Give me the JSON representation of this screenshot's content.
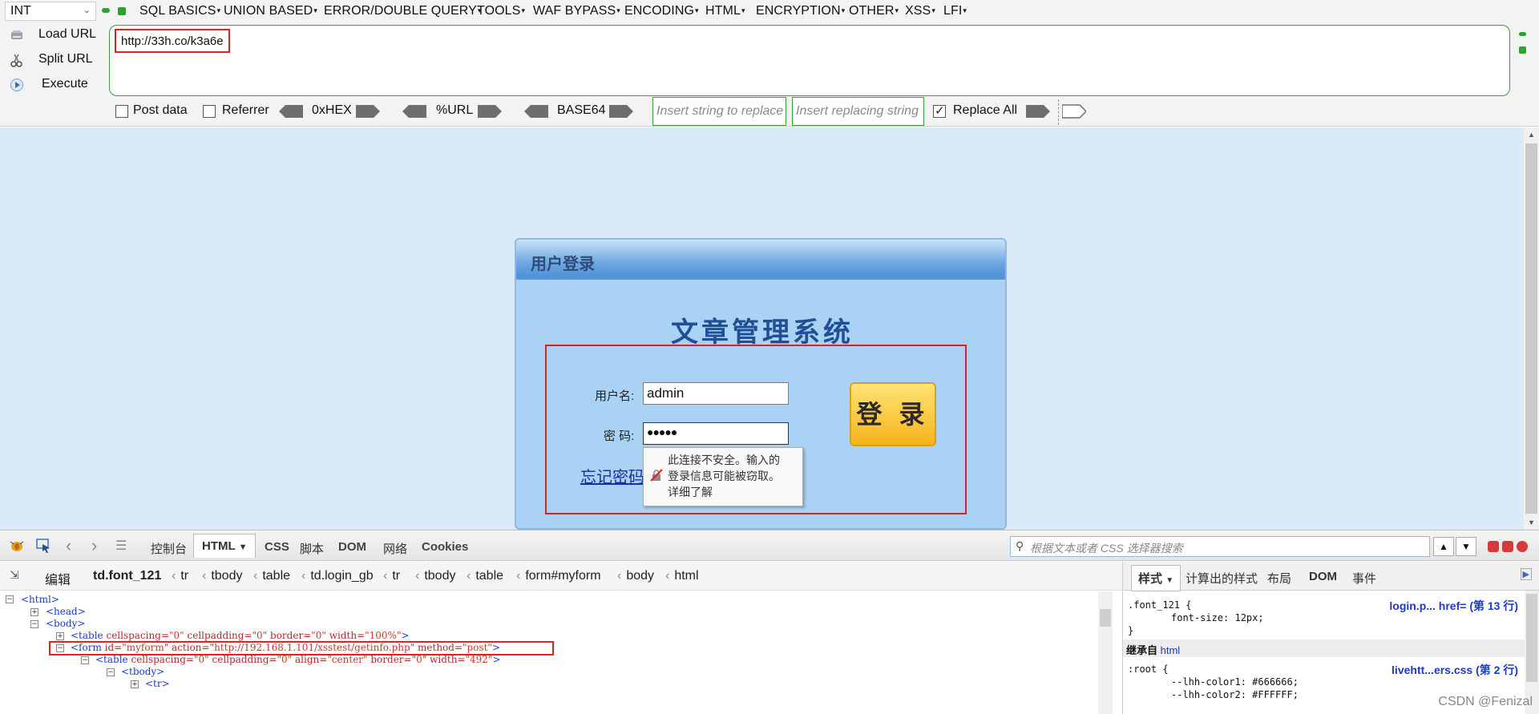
{
  "hackbar": {
    "type_select": "INT",
    "menus": [
      "SQL BASICS",
      "UNION BASED",
      "ERROR/DOUBLE QUERY",
      "TOOLS",
      "WAF BYPASS",
      "ENCODING",
      "HTML",
      "ENCRYPTION",
      "OTHER",
      "XSS",
      "LFI"
    ],
    "load_url": "Load URL",
    "split_url": "Split URL",
    "execute": "Execute",
    "url": "http://33h.co/k3a6e",
    "post_data": "Post data",
    "referrer": "Referrer",
    "hex": "0xHEX",
    "url_enc": "%URL",
    "base64": "BASE64",
    "replace_placeholder": "Insert string to replace",
    "replacing_placeholder": "Insert replacing string",
    "replace_all": "Replace All"
  },
  "login": {
    "header": "用户登录",
    "system_title": "文章管理系统",
    "username_label": "用户名:",
    "username_value": "admin",
    "password_label": "密 码:",
    "password_value": "●●●●●",
    "login_button": "登 录",
    "forgot_link": "忘记密码",
    "tooltip": [
      "此连接不安全。输入的",
      "登录信息可能被窃取。",
      "详细了解"
    ]
  },
  "devtools": {
    "tabs": [
      "控制台",
      "HTML",
      "CSS",
      "脚本",
      "DOM",
      "网络",
      "Cookies"
    ],
    "search_placeholder": "根据文本或者 CSS 选择器搜索",
    "edit": "编辑",
    "breadcrumbs": [
      "td.font_121",
      "tr",
      "tbody",
      "table",
      "td.login_gb",
      "tr",
      "tbody",
      "table",
      "form#myform",
      "body",
      "html"
    ],
    "tree": [
      {
        "text": "<html>"
      },
      {
        "text": "<head>"
      },
      {
        "text": "<body>"
      },
      {
        "tag": "<table",
        "attrs": [
          [
            "cellspacing",
            "\"0\""
          ],
          [
            "cellpadding",
            "\"0\""
          ],
          [
            "border",
            "\"0\""
          ],
          [
            "width",
            "\"100%\""
          ]
        ],
        "close": ">"
      },
      {
        "tag": "<form",
        "attrs": [
          [
            "id",
            "\"myform\""
          ],
          [
            "action",
            "\"http://192.168.1.101/xsstest/getinfo.php\""
          ],
          [
            "method",
            "\"post\""
          ]
        ],
        "close": ">"
      },
      {
        "tag": "<table",
        "attrs": [
          [
            "cellspacing",
            "\"0\""
          ],
          [
            "cellpadding",
            "\"0\""
          ],
          [
            "align",
            "\"center\""
          ],
          [
            "border",
            "\"0\""
          ],
          [
            "width",
            "\"492\""
          ]
        ],
        "close": ">"
      },
      {
        "text": "<tbody>"
      },
      {
        "text": "<tr>"
      }
    ],
    "side_tabs": [
      "样式",
      "计算出的样式",
      "布局",
      "DOM",
      "事件"
    ],
    "css_rule": {
      "selector": ".font_121 {",
      "prop": "font-size: 12px;",
      "close": "}",
      "source": "login.p... href= (第 13 行)"
    },
    "inherited_label": "继承自",
    "inherited_tag": "html",
    "root_rule": {
      "selector": ":root {",
      "line1": "--lhh-color1: #666666;",
      "line2": "--lhh-color2: #FFFFFF;",
      "source": "livehtt...ers.css (第 2 行)"
    }
  },
  "watermark": "CSDN @Fenizal",
  "colors": {
    "accent_green": "#3c9b3c",
    "highlight_red": "#e0221f",
    "page_bg": "#dbeaf8",
    "login_btn": "#f7b41a"
  }
}
